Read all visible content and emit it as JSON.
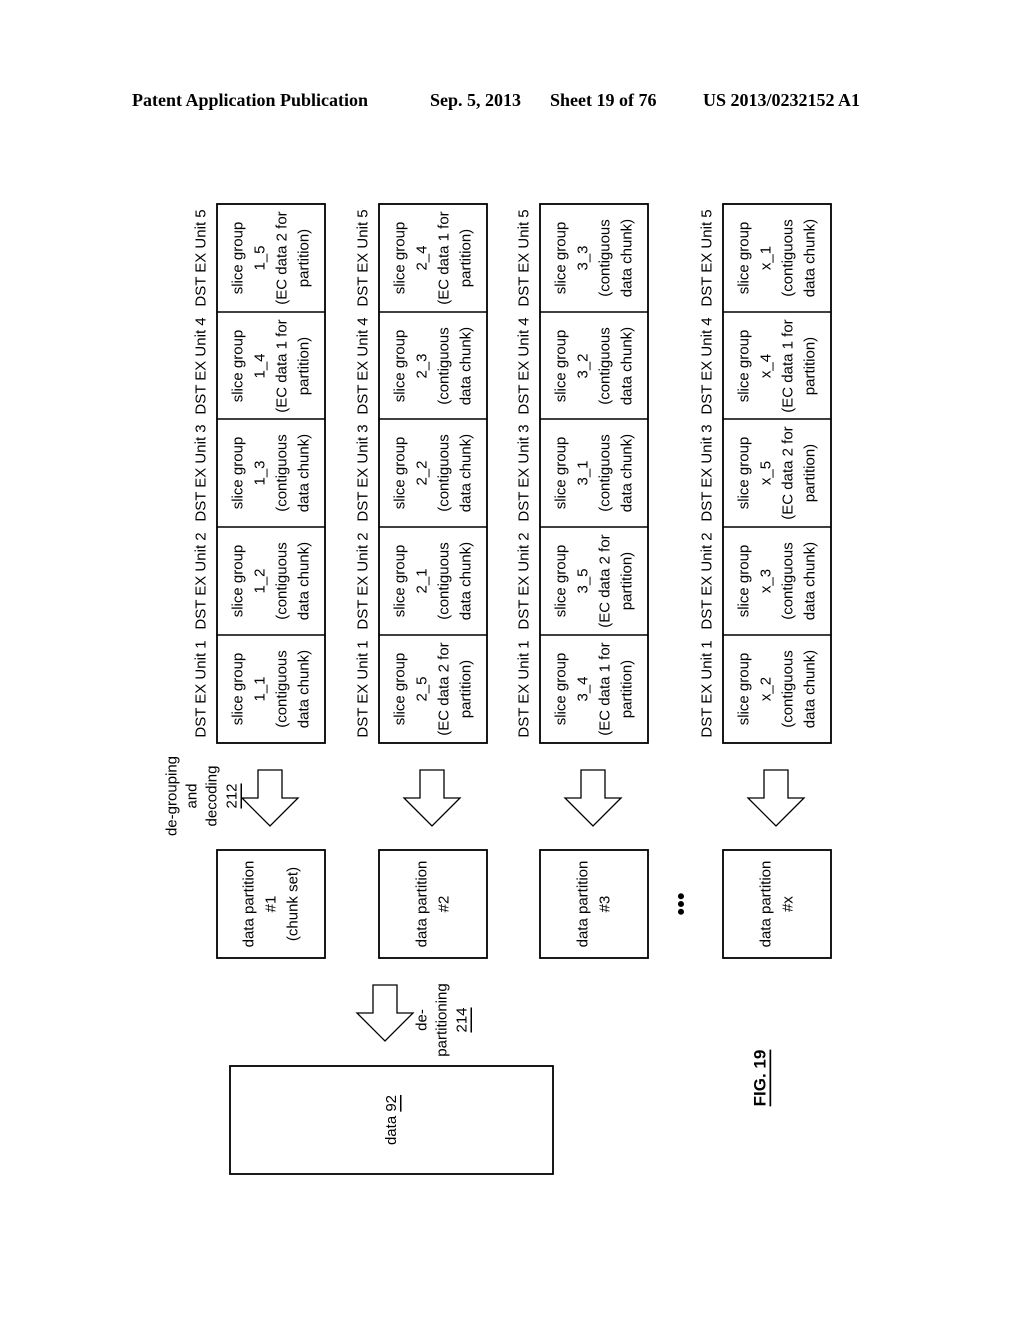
{
  "header": {
    "publication": "Patent Application Publication",
    "date": "Sep. 5, 2013",
    "sheet": "Sheet 19 of 76",
    "number": "US 2013/0232152 A1"
  },
  "figure_label": "FIG. 19",
  "unit_labels": [
    "DST EX Unit 1",
    "DST EX Unit 2",
    "DST EX Unit 3",
    "DST EX Unit 4",
    "DST EX Unit 5"
  ],
  "rows": [
    {
      "cells": [
        {
          "line1": "slice group",
          "line2": "1_1",
          "line3": "(contiguous",
          "line4": "data chunk)"
        },
        {
          "line1": "slice group",
          "line2": "1_2",
          "line3": "(contiguous",
          "line4": "data chunk)"
        },
        {
          "line1": "slice group",
          "line2": "1_3",
          "line3": "(contiguous",
          "line4": "data chunk)"
        },
        {
          "line1": "slice group",
          "line2": "1_4",
          "line3": "(EC data 1 for",
          "line4": "partition)"
        },
        {
          "line1": "slice group",
          "line2": "1_5",
          "line3": "(EC data 2 for",
          "line4": "partition)"
        }
      ],
      "partition": {
        "line1": "data partition",
        "line2": "#1",
        "line3": "(chunk set)"
      }
    },
    {
      "cells": [
        {
          "line1": "slice group",
          "line2": "2_5",
          "line3": "(EC data 2 for",
          "line4": "partition)"
        },
        {
          "line1": "slice group",
          "line2": "2_1",
          "line3": "(contiguous",
          "line4": "data chunk)"
        },
        {
          "line1": "slice group",
          "line2": "2_2",
          "line3": "(contiguous",
          "line4": "data chunk)"
        },
        {
          "line1": "slice group",
          "line2": "2_3",
          "line3": "(contiguous",
          "line4": "data chunk)"
        },
        {
          "line1": "slice group",
          "line2": "2_4",
          "line3": "(EC data 1 for",
          "line4": "partition)"
        }
      ],
      "partition": {
        "line1": "data partition",
        "line2": "#2",
        "line3": ""
      }
    },
    {
      "cells": [
        {
          "line1": "slice group",
          "line2": "3_4",
          "line3": "(EC data 1 for",
          "line4": "partition)"
        },
        {
          "line1": "slice group",
          "line2": "3_5",
          "line3": "(EC data 2 for",
          "line4": "partition)"
        },
        {
          "line1": "slice group",
          "line2": "3_1",
          "line3": "(contiguous",
          "line4": "data chunk)"
        },
        {
          "line1": "slice group",
          "line2": "3_2",
          "line3": "(contiguous",
          "line4": "data chunk)"
        },
        {
          "line1": "slice group",
          "line2": "3_3",
          "line3": "(contiguous",
          "line4": "data chunk)"
        }
      ],
      "partition": {
        "line1": "data partition",
        "line2": "#3",
        "line3": ""
      }
    },
    {
      "cells": [
        {
          "line1": "slice group",
          "line2": "x_2",
          "line3": "(contiguous",
          "line4": "data chunk)"
        },
        {
          "line1": "slice group",
          "line2": "x_3",
          "line3": "(contiguous",
          "line4": "data chunk)"
        },
        {
          "line1": "slice group",
          "line2": "x_5",
          "line3": "(EC data 2 for",
          "line4": "partition)"
        },
        {
          "line1": "slice group",
          "line2": "x_4",
          "line3": "(EC data 1 for",
          "line4": "partition)"
        },
        {
          "line1": "slice group",
          "line2": "x_1",
          "line3": "(contiguous",
          "line4": "data chunk)"
        }
      ],
      "partition": {
        "line1": "data partition",
        "line2": "#x",
        "line3": ""
      }
    }
  ],
  "degrouping_label": {
    "line1": "de-grouping",
    "line2": "and",
    "line3": "decoding",
    "ref": "212"
  },
  "departitioning_label": {
    "line1": "de-",
    "line2": "partitioning",
    "ref": "214"
  },
  "data_box": {
    "text": "data ",
    "ref": "92"
  },
  "ellipsis": "•••"
}
